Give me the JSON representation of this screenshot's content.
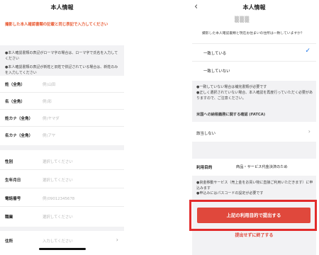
{
  "left": {
    "title": "本人情報",
    "warning": "撮影した本人確認書類の記載と同じ表記で入力してください",
    "notes": [
      "●本人確認書類の表記がローマ字の場合は、ローマ字で氏名を入力してください",
      "●本人確認書類の表記が新姓と旧姓で併記されている場合は、新姓のみを入力してください"
    ],
    "name_fields": [
      {
        "label": "姓（全角）",
        "placeholder": "例)山田"
      },
      {
        "label": "名（全角）",
        "placeholder": "例)彩"
      },
      {
        "label": "姓カナ（全角）",
        "placeholder": "例)ヤマダ"
      },
      {
        "label": "名カナ（全角）",
        "placeholder": "例)アヤ"
      }
    ],
    "info_fields": [
      {
        "label": "性別",
        "placeholder": "選択してください"
      },
      {
        "label": "生年月日",
        "placeholder": "選択してください"
      },
      {
        "label": "電話番号",
        "placeholder": "例)09012345678"
      },
      {
        "label": "職業",
        "placeholder": "選択してください"
      }
    ],
    "address": {
      "label": "住所",
      "placeholder": "入力してください"
    }
  },
  "right": {
    "title": "本人情報",
    "masked_value": "▒▒▒",
    "question": "撮影した本人確認書類と現在お住まいの住所は一致していますか？",
    "choices": [
      "一致している",
      "一致していない"
    ],
    "note_1": "●一致していない場合は補完書類が必要です\n●正しく選択されていない場合、本人確認を再度行っていただく必要がありますので、ご注意ください。",
    "fatca_heading": "米国への納税義務に関する確認 (FATCA)",
    "fatca_value": "該当しない",
    "purpose_label": "利用目的",
    "purpose_value": "商品・サービス代金決済のため",
    "note_2": "●資金移動サービス（売上金をお買い物に直接ご利用いただきます）に申込みます\n●申込みにはパスコードの設定が必要です",
    "submit_label": "上記の利用目的で提出する",
    "end_label": "提出せずに終了する"
  },
  "colors": {
    "accent_red": "#e0483c",
    "warning_orange": "#e8572f",
    "check_blue": "#1a73e8",
    "highlight_border": "#e22b2b"
  }
}
